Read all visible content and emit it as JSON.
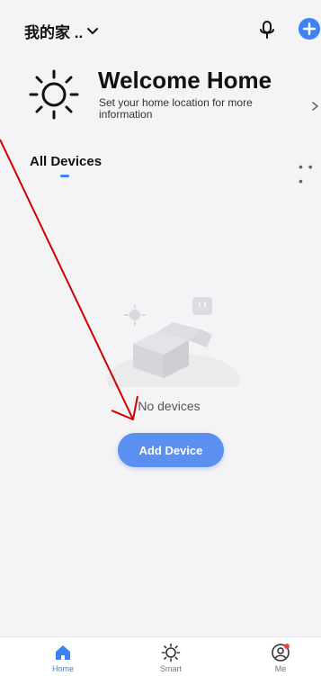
{
  "header": {
    "home_name": "我的家 .."
  },
  "welcome": {
    "title": "Welcome Home",
    "subtitle": "Set your home location for more information"
  },
  "tabs": {
    "active": "All Devices"
  },
  "empty_state": {
    "message": "No devices",
    "button_label": "Add Device"
  },
  "bottom_nav": [
    {
      "label": "Home",
      "icon": "home-icon",
      "active": true
    },
    {
      "label": "Smart",
      "icon": "sun-icon",
      "active": false
    },
    {
      "label": "Me",
      "icon": "user-icon",
      "active": false,
      "badge": true
    }
  ],
  "colors": {
    "accent": "#3b82f6",
    "button": "#5b8ff0",
    "badge": "#ef4444",
    "background": "#f4f4f6",
    "annotation": "#d10000"
  }
}
